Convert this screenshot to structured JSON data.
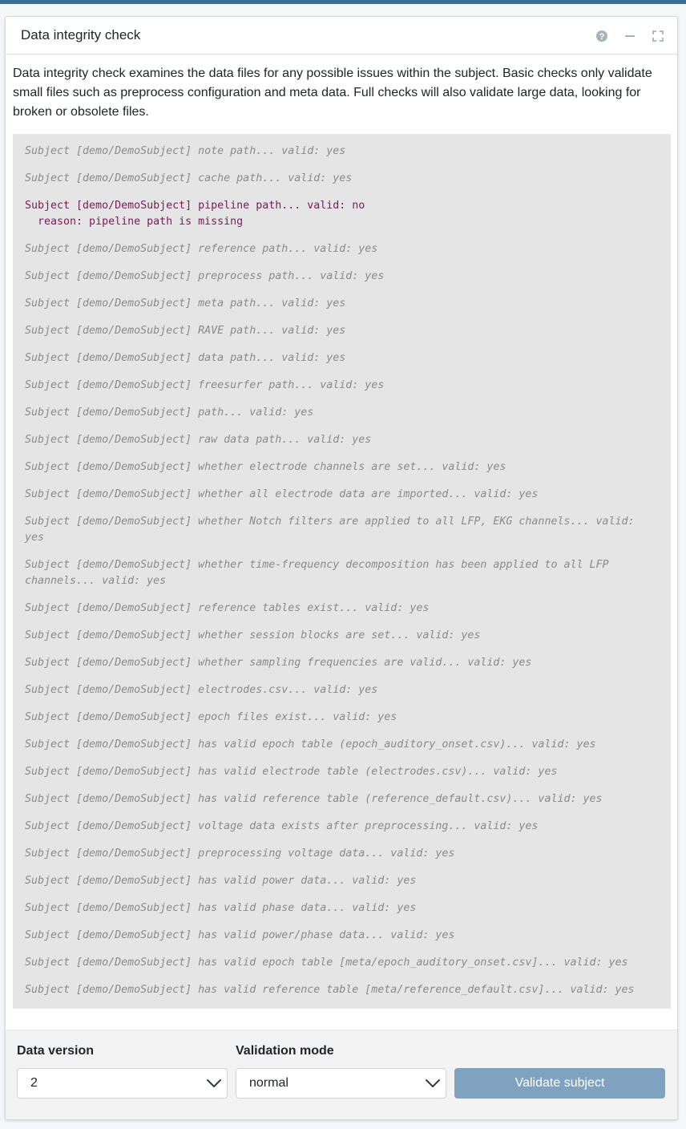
{
  "card": {
    "title": "Data integrity check",
    "description": "Data integrity check examines the data files for any possible issues within the subject. Basic checks only validate small files such as preprocess configuration and meta data. Full checks will also validate large data, looking for broken or obsolete files.",
    "tools": {
      "help": "help-icon",
      "minimize": "minimize-icon",
      "maximize": "maximize-icon"
    }
  },
  "log": {
    "lines": [
      {
        "text": "Subject [demo/DemoSubject] note path... valid: yes",
        "status": "valid"
      },
      {
        "text": "Subject [demo/DemoSubject] cache path... valid: yes",
        "status": "valid"
      },
      {
        "text": "Subject [demo/DemoSubject] pipeline path... valid: no\n  reason: pipeline path is missing",
        "status": "error"
      },
      {
        "text": "Subject [demo/DemoSubject] reference path... valid: yes",
        "status": "valid"
      },
      {
        "text": "Subject [demo/DemoSubject] preprocess path... valid: yes",
        "status": "valid"
      },
      {
        "text": "Subject [demo/DemoSubject] meta path... valid: yes",
        "status": "valid"
      },
      {
        "text": "Subject [demo/DemoSubject] RAVE path... valid: yes",
        "status": "valid"
      },
      {
        "text": "Subject [demo/DemoSubject] data path... valid: yes",
        "status": "valid"
      },
      {
        "text": "Subject [demo/DemoSubject] freesurfer path... valid: yes",
        "status": "valid"
      },
      {
        "text": "Subject [demo/DemoSubject] path... valid: yes",
        "status": "valid"
      },
      {
        "text": "Subject [demo/DemoSubject] raw data path... valid: yes",
        "status": "valid"
      },
      {
        "text": "Subject [demo/DemoSubject] whether electrode channels are set... valid: yes",
        "status": "valid"
      },
      {
        "text": "Subject [demo/DemoSubject] whether all electrode data are imported... valid: yes",
        "status": "valid"
      },
      {
        "text": "Subject [demo/DemoSubject] whether Notch filters are applied to all LFP, EKG channels... valid:\nyes",
        "status": "valid"
      },
      {
        "text": "Subject [demo/DemoSubject] whether time-frequency decomposition has been applied to all LFP\nchannels... valid: yes",
        "status": "valid"
      },
      {
        "text": "Subject [demo/DemoSubject] reference tables exist... valid: yes",
        "status": "valid"
      },
      {
        "text": "Subject [demo/DemoSubject] whether session blocks are set... valid: yes",
        "status": "valid"
      },
      {
        "text": "Subject [demo/DemoSubject] whether sampling frequencies are valid... valid: yes",
        "status": "valid"
      },
      {
        "text": "Subject [demo/DemoSubject] electrodes.csv... valid: yes",
        "status": "valid"
      },
      {
        "text": "Subject [demo/DemoSubject] epoch files exist... valid: yes",
        "status": "valid"
      },
      {
        "text": "Subject [demo/DemoSubject] has valid epoch table (epoch_auditory_onset.csv)... valid: yes",
        "status": "valid"
      },
      {
        "text": "Subject [demo/DemoSubject] has valid electrode table (electrodes.csv)... valid: yes",
        "status": "valid"
      },
      {
        "text": "Subject [demo/DemoSubject] has valid reference table (reference_default.csv)... valid: yes",
        "status": "valid"
      },
      {
        "text": "Subject [demo/DemoSubject] voltage data exists after preprocessing... valid: yes",
        "status": "valid"
      },
      {
        "text": "Subject [demo/DemoSubject] preprocessing voltage data... valid: yes",
        "status": "valid"
      },
      {
        "text": "Subject [demo/DemoSubject] has valid power data... valid: yes",
        "status": "valid"
      },
      {
        "text": "Subject [demo/DemoSubject] has valid phase data... valid: yes",
        "status": "valid"
      },
      {
        "text": "Subject [demo/DemoSubject] has valid power/phase data... valid: yes",
        "status": "valid"
      },
      {
        "text": "Subject [demo/DemoSubject] has valid epoch table [meta/epoch_auditory_onset.csv]... valid: yes",
        "status": "valid"
      },
      {
        "text": "Subject [demo/DemoSubject] has valid reference table [meta/reference_default.csv]... valid: yes",
        "status": "valid"
      }
    ]
  },
  "footer": {
    "data_version": {
      "label": "Data version",
      "value": "2"
    },
    "validation_mode": {
      "label": "Validation mode",
      "value": "normal"
    },
    "validate_button": "Validate subject"
  },
  "colors": {
    "brand_strip": "#3c6f93",
    "log_background": "#e5e5e5",
    "log_text": "#8a8a8a",
    "log_error": "#7a1a5c",
    "button": "#7ea2c0"
  }
}
